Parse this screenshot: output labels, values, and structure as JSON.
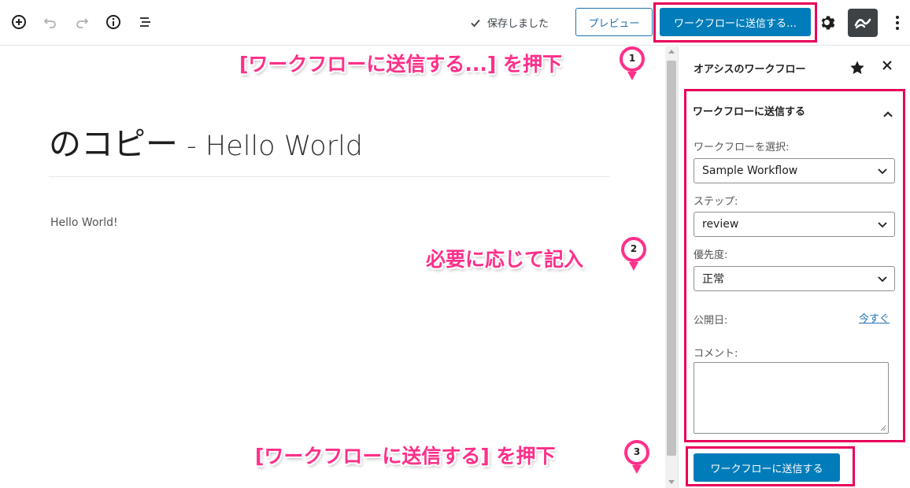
{
  "toolbar": {
    "saved_text": "保存しました",
    "preview_label": "プレビュー",
    "submit_label": "ワークフローに送信する…"
  },
  "editor": {
    "title_main": "のコピー",
    "title_sub": " - Hello World",
    "body": "Hello World!"
  },
  "sidebar": {
    "title": "オアシスのワークフロー",
    "panel_title": "ワークフローに送信する",
    "workflow_label": "ワークフローを選択:",
    "workflow_value": "Sample Workflow",
    "step_label": "ステップ:",
    "step_value": "review",
    "priority_label": "優先度:",
    "priority_value": "正常",
    "publish_label": "公開日:",
    "publish_link": "今すぐ",
    "comment_label": "コメント:",
    "submit_label": "ワークフローに送信する"
  },
  "annotations": [
    {
      "number": "1",
      "text": "[ワークフローに送信する...] を押下"
    },
    {
      "number": "2",
      "text": "必要に応じて記入"
    },
    {
      "number": "3",
      "text": "[ワークフローに送信する] を押下"
    }
  ],
  "colors": {
    "primary": "#007cba",
    "highlight": "#e8005a",
    "callout": "#ff2f8a"
  }
}
